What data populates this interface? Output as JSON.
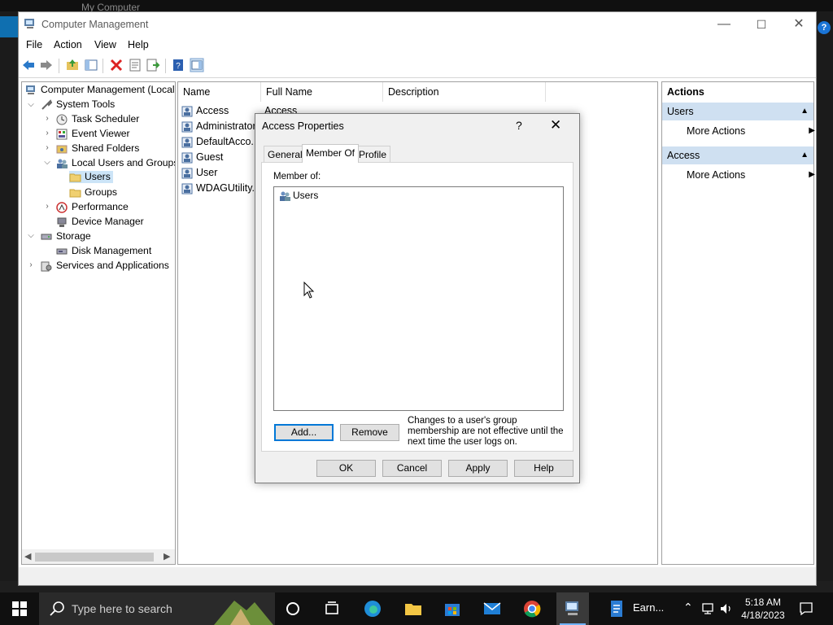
{
  "background": {
    "window_title": "My Computer"
  },
  "window": {
    "title": "Computer Management",
    "controls": {
      "minimize": "—",
      "maximize": "☐",
      "close": "✕"
    }
  },
  "menu": [
    "File",
    "Action",
    "View",
    "Help"
  ],
  "tree": {
    "items": [
      {
        "label": "Computer Management (Local",
        "icon": "computer-management-icon"
      },
      {
        "label": "System Tools",
        "icon": "tools-icon"
      },
      {
        "label": "Task Scheduler",
        "icon": "clock-icon"
      },
      {
        "label": "Event Viewer",
        "icon": "event-viewer-icon"
      },
      {
        "label": "Shared Folders",
        "icon": "shared-folder-icon"
      },
      {
        "label": "Local Users and Groups",
        "icon": "users-icon"
      },
      {
        "label": "Users",
        "icon": "folder-icon",
        "selected": true
      },
      {
        "label": "Groups",
        "icon": "folder-icon"
      },
      {
        "label": "Performance",
        "icon": "performance-icon"
      },
      {
        "label": "Device Manager",
        "icon": "device-manager-icon"
      },
      {
        "label": "Storage",
        "icon": "storage-icon"
      },
      {
        "label": "Disk Management",
        "icon": "disk-icon"
      },
      {
        "label": "Services and Applications",
        "icon": "services-icon"
      }
    ],
    "chevrons": {
      "expanded": "⌵",
      "collapsed": "›"
    }
  },
  "list": {
    "columns": [
      "Name",
      "Full Name",
      "Description"
    ],
    "rows": [
      {
        "name": "Access",
        "full_name": "Access"
      },
      {
        "name": "Administrator"
      },
      {
        "name": "DefaultAcco..."
      },
      {
        "name": "Guest"
      },
      {
        "name": "User"
      },
      {
        "name": "WDAGUtility..."
      }
    ]
  },
  "actions": {
    "header": "Actions",
    "sections": [
      {
        "title": "Users",
        "item": "More Actions"
      },
      {
        "title": "Access",
        "item": "More Actions"
      }
    ]
  },
  "dialog": {
    "title": "Access Properties",
    "help": "?",
    "close": "✕",
    "tabs": [
      "General",
      "Member Of",
      "Profile"
    ],
    "selected_tab": "Member Of",
    "member_of_label": "Member of:",
    "members": [
      "Users"
    ],
    "add_label": "Add...",
    "remove_label": "Remove",
    "note": "Changes to a user's group membership are not effective until the next time the user logs on.",
    "ok_label": "OK",
    "cancel_label": "Cancel",
    "apply_label": "Apply",
    "help_label": "Help"
  },
  "taskbar": {
    "search_placeholder": "Type here to search",
    "earn_label": "Earn...",
    "time": "5:18 AM",
    "date": "4/18/2023"
  },
  "colors": {
    "accent": "#0078d7",
    "section": "#cfe0f1",
    "taskbar": "#101010"
  }
}
